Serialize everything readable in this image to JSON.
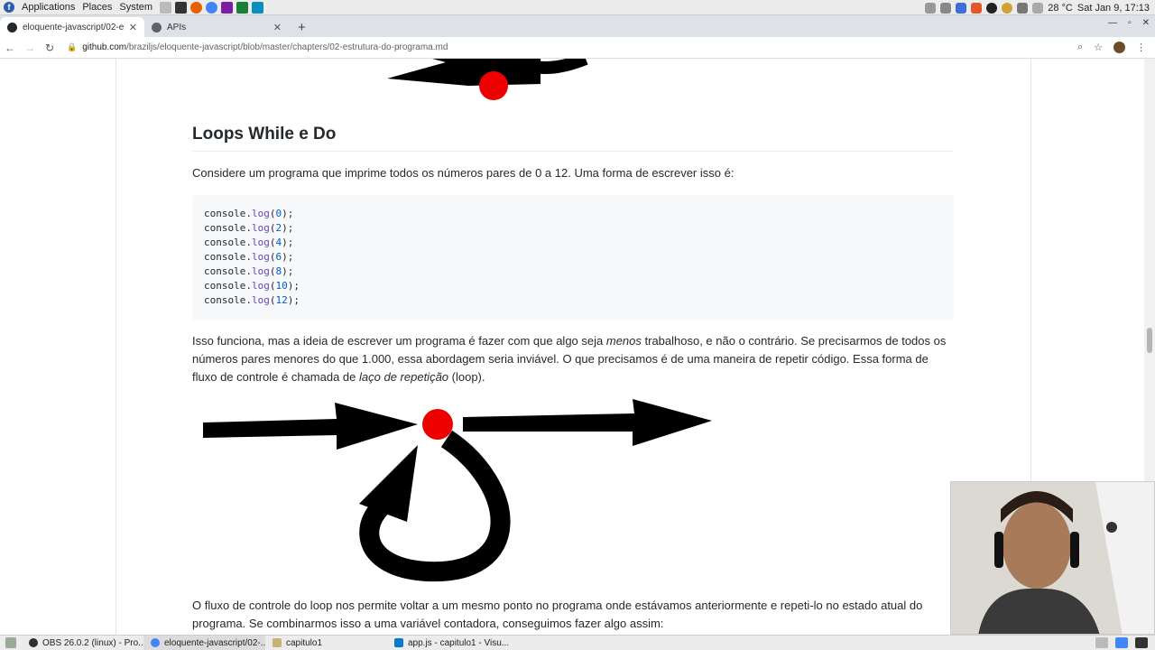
{
  "system_panel": {
    "menus": [
      "Applications",
      "Places",
      "System"
    ],
    "clock": "Sat Jan  9, 17:13",
    "temperature": "28 °C"
  },
  "browser": {
    "tabs": [
      {
        "title": "eloquente-javascript/02-e",
        "active": true
      },
      {
        "title": "APIs",
        "active": false
      }
    ],
    "url_host": "github.com",
    "url_path": "/braziljs/eloquente-javascript/blob/master/chapters/02-estrutura-do-programa.md"
  },
  "article": {
    "heading": "Loops While e Do",
    "intro": "Considere um programa que imprime todos os números pares de 0 a 12. Uma forma de escrever isso é:",
    "code_lines": [
      {
        "obj": "console",
        "fn": "log",
        "arg": "0"
      },
      {
        "obj": "console",
        "fn": "log",
        "arg": "2"
      },
      {
        "obj": "console",
        "fn": "log",
        "arg": "4"
      },
      {
        "obj": "console",
        "fn": "log",
        "arg": "6"
      },
      {
        "obj": "console",
        "fn": "log",
        "arg": "8"
      },
      {
        "obj": "console",
        "fn": "log",
        "arg": "10"
      },
      {
        "obj": "console",
        "fn": "log",
        "arg": "12"
      }
    ],
    "para2_a": "Isso funciona, mas a ideia de escrever um programa é fazer com que algo seja ",
    "para2_em": "menos",
    "para2_b": " trabalhoso, e não o contrário. Se precisarmos de todos os números pares menores do que 1.000, essa abordagem seria inviável. O que precisamos é de uma maneira de repetir código. Essa forma de fluxo de controle é chamada de ",
    "para2_em2": "laço de repetição",
    "para2_c": " (loop).",
    "para3": "O fluxo de controle do loop nos permite voltar a um mesmo ponto no programa onde estávamos anteriormente e repeti-lo no estado atual do programa. Se combinarmos isso a uma variável contadora, conseguimos fazer algo assim:"
  },
  "taskbar": {
    "tasks": [
      "OBS 26.0.2 (linux) - Pro...",
      "eloquente-javascript/02-...",
      "capitulo1",
      "app.js - capitulo1 - Visu..."
    ]
  },
  "colors": {
    "accent_red": "#ee0000",
    "text": "#24292e",
    "code_bg": "#f6f8fa"
  }
}
